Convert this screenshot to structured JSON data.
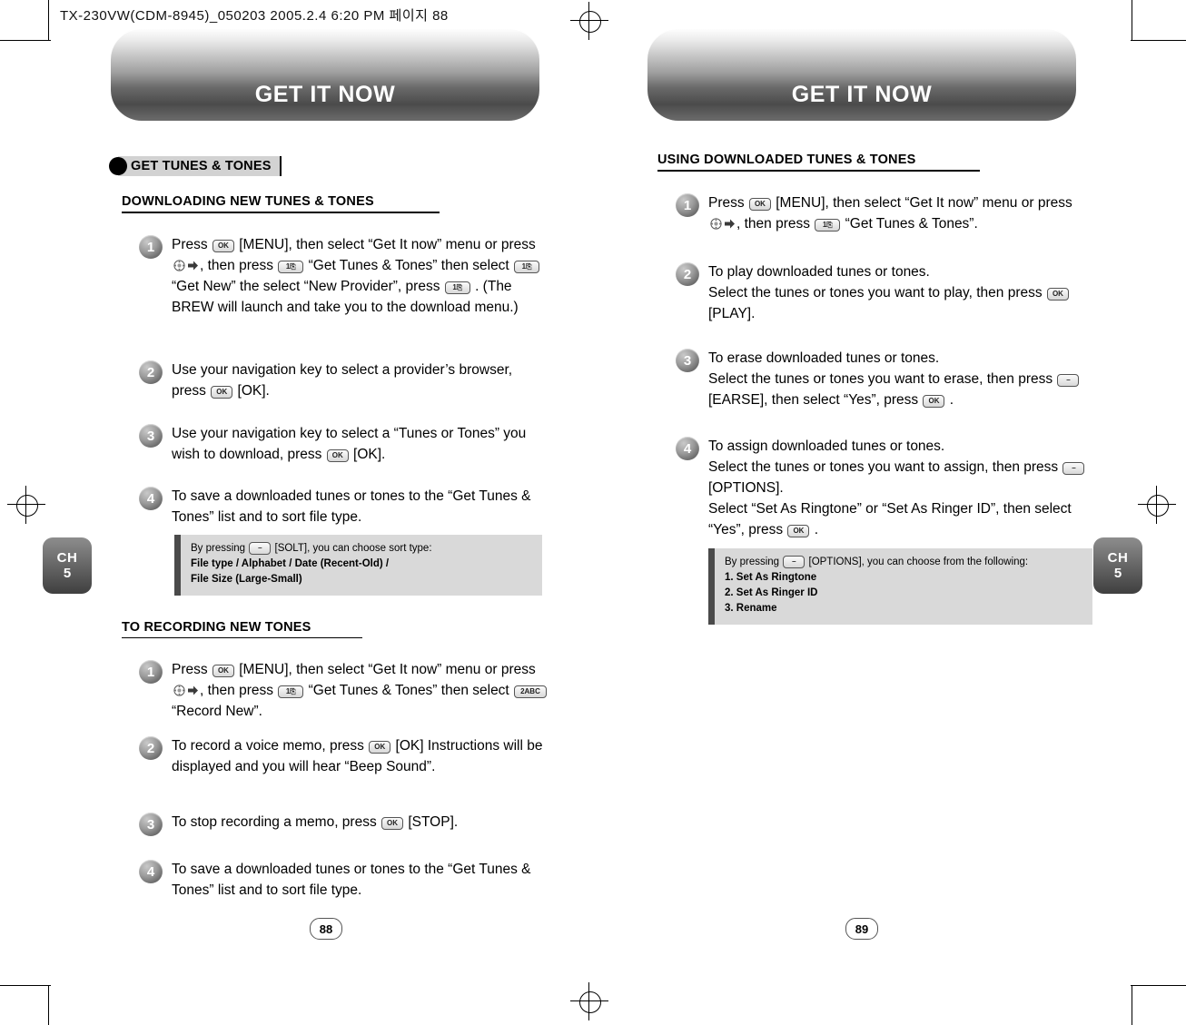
{
  "print_strip": "TX-230VW(CDM-8945)_050203  2005.2.4 6:20 PM  페이지 88",
  "left_page": {
    "banner_title": "GET IT NOW",
    "section_heading": "GET TUNES & TONES",
    "sub_head_1": "DOWNLOADING NEW TUNES & TONES",
    "steps_1": [
      {
        "num": "1",
        "html": "Press <span class=\"key\">OK</span> [MENU], then select “Get It now” menu or press <span class=\"key-nav\"></span><span class=\"key-arrow\"></span>, then press <span class=\"key wide\">1⎘</span> “Get Tunes &amp; Tones” then select <span class=\"key wide\">1⎘</span> “Get New” the select “New Provider”, press <span class=\"key wide\">1⎘</span> . (The BREW will launch and take you to the download menu.)"
      },
      {
        "num": "2",
        "html": "Use your navigation key to select a provider’s browser, press <span class=\"key\">OK</span> [OK]."
      },
      {
        "num": "3",
        "html": "Use your navigation key to select a “Tunes or Tones” you wish to download, press <span class=\"key\">OK</span> [OK]."
      },
      {
        "num": "4",
        "html": "To save a downloaded tunes or tones to the “Get Tunes &amp; Tones” list and to sort file type."
      }
    ],
    "note_1": {
      "line1_pre": "By pressing",
      "line1_key": "–",
      "line1_post": "[SOLT], you can choose sort type:",
      "line2": "File type / Alphabet / Date (Recent-Old) /",
      "line3": "File Size (Large-Small)"
    },
    "sub_head_2": "TO RECORDING NEW TONES",
    "steps_2": [
      {
        "num": "1",
        "html": "Press <span class=\"key\">OK</span> [MENU], then select “Get It now” menu or press <span class=\"key-nav\"></span><span class=\"key-arrow\"></span>, then press <span class=\"key wide\">1⎘</span> “Get Tunes &amp; Tones” then select <span class=\"key wide\">2ABC</span> “Record New”."
      },
      {
        "num": "2",
        "html": "To record a voice memo, press <span class=\"key\">OK</span> [OK] Instructions will be displayed and you will hear “Beep Sound”."
      },
      {
        "num": "3",
        "html": "To stop recording a memo, press <span class=\"key\">OK</span> [STOP]."
      },
      {
        "num": "4",
        "html": "To save a downloaded tunes or tones to the “Get Tunes &amp; Tones” list and to sort file type."
      }
    ],
    "chapter_label": "CH",
    "chapter_number": "5",
    "page_number": "88"
  },
  "right_page": {
    "banner_title": "GET IT NOW",
    "sub_head_1": "USING DOWNLOADED TUNES & TONES",
    "steps_1": [
      {
        "num": "1",
        "html": "Press <span class=\"key\">OK</span> [MENU], then select “Get It now” menu or press <span class=\"key-nav\"></span><span class=\"key-arrow\"></span>, then press <span class=\"key wide\">1⎘</span> “Get Tunes &amp; Tones”."
      },
      {
        "num": "2",
        "html": "To play downloaded tunes or tones.<br>Select the tunes or tones you want to play, then press <span class=\"key\">OK</span> [PLAY]."
      },
      {
        "num": "3",
        "html": "To erase downloaded tunes or tones.<br>Select the tunes or tones you want to erase, then press <span class=\"key\">–</span> [EARSE], then select “Yes”, press <span class=\"key\">OK</span> ."
      },
      {
        "num": "4",
        "html": "To assign downloaded tunes or tones.<br>Select the tunes or tones you want to assign, then press <span class=\"key\">–</span> [OPTIONS].<br>Select “Set As Ringtone” or “Set As Ringer ID”, then select “Yes”, press <span class=\"key\">OK</span> ."
      }
    ],
    "note_1": {
      "line1_pre": "By pressing",
      "line1_key": "–",
      "line1_post": "[OPTIONS], you can choose from the following:",
      "line2": "1. Set As Ringtone",
      "line3": "2. Set As Ringer ID",
      "line4": "3. Rename"
    },
    "chapter_label": "CH",
    "chapter_number": "5",
    "page_number": "89"
  }
}
